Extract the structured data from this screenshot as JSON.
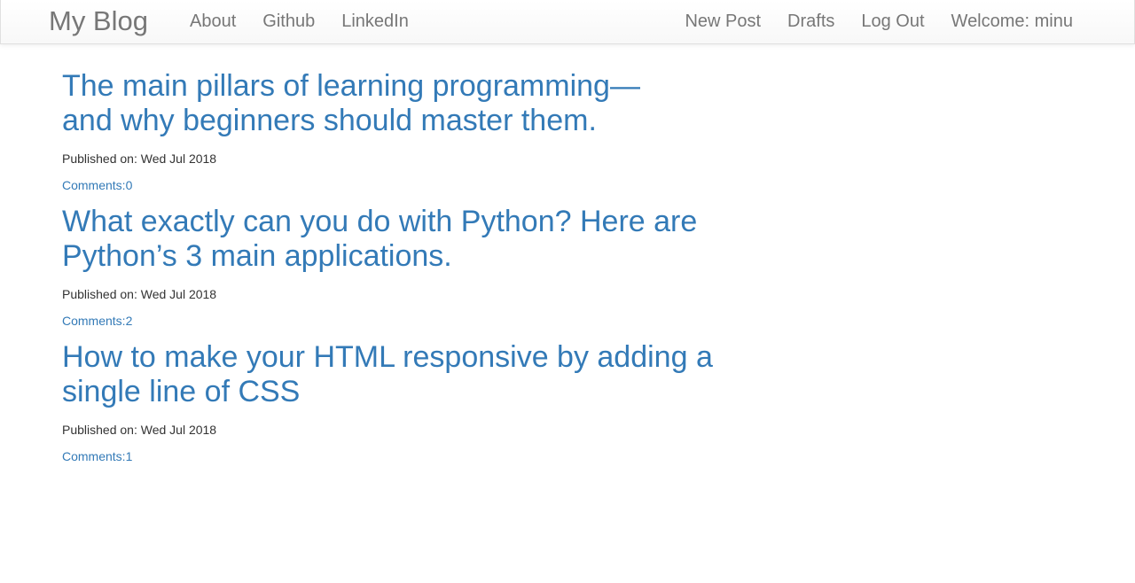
{
  "navbar": {
    "brand": "My Blog",
    "left_links": [
      "About",
      "Github",
      "LinkedIn"
    ],
    "right_links": [
      "New Post",
      "Drafts",
      "Log Out"
    ],
    "welcome": "Welcome: minu"
  },
  "posts": [
    {
      "title": "The main pillars of learning programming—and why beginners should master them.",
      "published": "Published on: Wed Jul 2018",
      "comments": "Comments:0"
    },
    {
      "title": "What exactly can you do with Python? Here are Python’s 3 main applications.",
      "published": "Published on: Wed Jul 2018",
      "comments": "Comments:2"
    },
    {
      "title": "How to make your HTML responsive by adding a single line of CSS",
      "published": "Published on: Wed Jul 2018",
      "comments": "Comments:1"
    }
  ],
  "colors": {
    "link": "#337ab7",
    "nav_text": "#777777",
    "body_text": "#333333"
  }
}
